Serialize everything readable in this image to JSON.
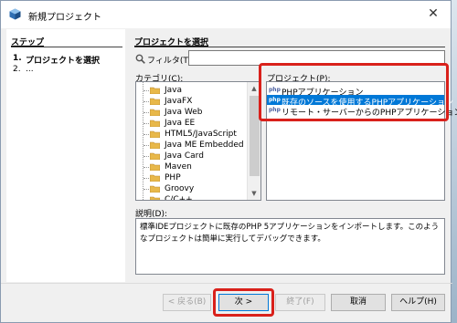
{
  "window": {
    "title": "新規プロジェクト"
  },
  "steps": {
    "heading": "ステップ",
    "items": [
      {
        "num": "1.",
        "label": "プロジェクトを選択"
      },
      {
        "num": "2.",
        "label": "..."
      }
    ]
  },
  "main": {
    "heading": "プロジェクトを選択"
  },
  "filter": {
    "label": "フィルタ(T):",
    "value": ""
  },
  "categories": {
    "label": "カテゴリ(C):",
    "items": [
      "Java",
      "JavaFX",
      "Java Web",
      "Java EE",
      "HTML5/JavaScript",
      "Java ME Embedded",
      "Java Card",
      "Maven",
      "PHP",
      "Groovy",
      "C/C++"
    ]
  },
  "projects": {
    "label": "プロジェクト(P):",
    "items": [
      {
        "label": "PHPアプリケーション",
        "selected": false
      },
      {
        "label": "既存のソースを使用するPHPアプリケーション",
        "selected": true
      },
      {
        "label": "リモート・サーバーからのPHPアプリケーション",
        "selected": false
      }
    ]
  },
  "description": {
    "label": "説明(D):",
    "text": "標準IDEプロジェクトに既存のPHP 5アプリケーションをインポートします。このようなプロジェクトは簡単に実行してデバッグできます。"
  },
  "buttons": {
    "back": "< 戻る(B)",
    "next": "次 >",
    "finish": "終了(F)",
    "cancel": "取消",
    "help": "ヘルプ(H)"
  },
  "colors": {
    "selection": "#0078d7",
    "annotation_red": "#d9211b",
    "folder": "#e8b84a"
  }
}
